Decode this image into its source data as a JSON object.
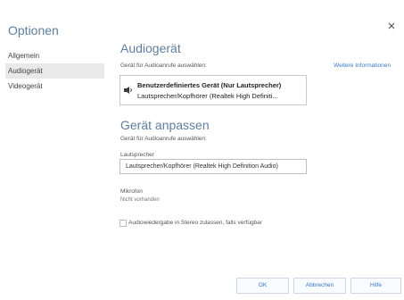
{
  "dialog": {
    "title": "Optionen",
    "close_label": "×"
  },
  "sidebar": {
    "items": [
      {
        "label": "Allgemein",
        "active": false
      },
      {
        "label": "Audiogerät",
        "active": true
      },
      {
        "label": "Videogerät",
        "active": false
      }
    ]
  },
  "audio_device": {
    "header": "Audiogerät",
    "select_label": "Gerät für Audioanrufe auswählen:",
    "more_info_link": "Weitere Informationen",
    "device_title": "Benutzerdefiniertes Gerät (Nur Lautsprecher)",
    "device_subtitle": "Lautsprecher/Kopfhörer (Realtek High Definiti..."
  },
  "customize": {
    "header": "Gerät anpassen",
    "select_label": "Gerät für Audioanrufe auswählen:",
    "speaker_label": "Lautsprecher",
    "speaker_value": "Lautsprecher/Kopfhörer (Realtek High Definition Audio)",
    "mic_label": "Mikrofon",
    "mic_status": "Nicht vorhanden",
    "checkbox_label": "Audiowiedergabe in Stereo zulassen, falls verfügbar"
  },
  "buttons": {
    "ok": "OK",
    "cancel": "Abbrechen",
    "help": "Hilfe"
  }
}
